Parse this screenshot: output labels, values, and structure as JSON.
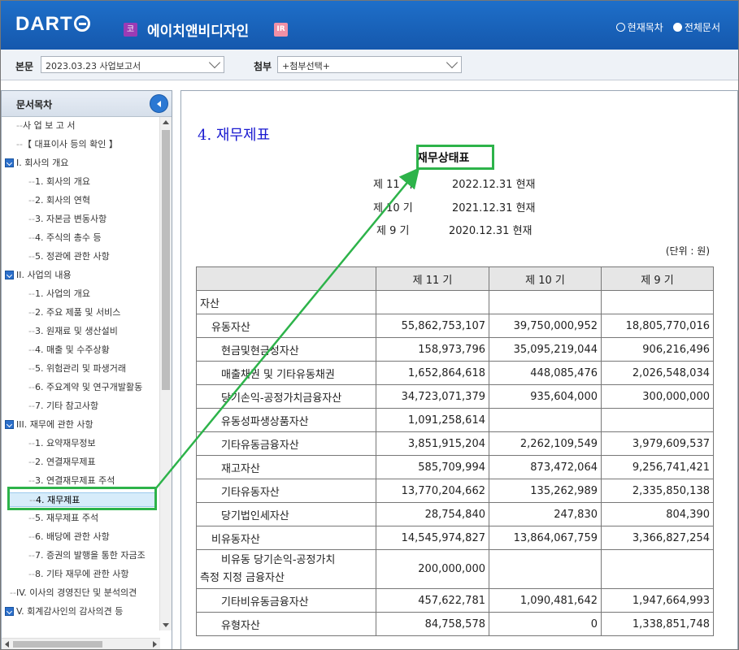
{
  "header": {
    "logo_text": "DART",
    "company_badge": "코",
    "company_name": "에이치앤비디자인",
    "ir_badge": "IR",
    "radio_current": "현재목차",
    "radio_all": "전체문서"
  },
  "selectbar": {
    "body_label": "본문",
    "body_value": "2023.03.23  사업보고서",
    "attach_label": "첨부",
    "attach_value": "+첨부선택+"
  },
  "sidebar": {
    "title": "문서목차",
    "items": [
      {
        "label": "사 업 보 고 서"
      },
      {
        "label": "【 대표이사 등의 확인 】"
      },
      {
        "label": "I. 회사의 개요"
      },
      {
        "label": "1. 회사의 개요"
      },
      {
        "label": "2. 회사의 연혁"
      },
      {
        "label": "3. 자본금 변동사항"
      },
      {
        "label": "4. 주식의 총수 등"
      },
      {
        "label": "5. 정관에 관한 사항"
      },
      {
        "label": "II. 사업의 내용"
      },
      {
        "label": "1. 사업의 개요"
      },
      {
        "label": "2. 주요 제품 및 서비스"
      },
      {
        "label": "3. 원재료 및 생산설비"
      },
      {
        "label": "4. 매출 및 수주상황"
      },
      {
        "label": "5. 위험관리 및 파생거래"
      },
      {
        "label": "6. 주요계약 및 연구개발활동"
      },
      {
        "label": "7. 기타 참고사항"
      },
      {
        "label": "III. 재무에 관한 사항"
      },
      {
        "label": "1. 요약재무정보"
      },
      {
        "label": "2. 연결재무제표"
      },
      {
        "label": "3. 연결재무제표 주석"
      },
      {
        "label": "4. 재무제표"
      },
      {
        "label": "5. 재무제표 주석"
      },
      {
        "label": "6. 배당에 관한 사항"
      },
      {
        "label": "7. 증권의 발행을 통한 자금조"
      },
      {
        "label": "8. 기타 재무에 관한 사항"
      },
      {
        "label": "IV. 이사의 경영진단 및 분석의견"
      },
      {
        "label": "V. 회계감사인의 감사의견 등"
      }
    ]
  },
  "content": {
    "doc_title": "4. 재무제표",
    "fs_title": "재무상태표",
    "periods": [
      {
        "label": "제 11 기",
        "date": "2022.12.31 현재"
      },
      {
        "label": "제 10 기",
        "date": "2021.12.31 현재"
      },
      {
        "label": "제 9 기",
        "date": "2020.12.31 현재"
      }
    ],
    "unit": "(단위 : 원)",
    "columns": [
      "",
      "제 11 기",
      "제 10 기",
      "제 9 기"
    ],
    "rows": [
      {
        "account": "자산",
        "v11": "",
        "v10": "",
        "v9": ""
      },
      {
        "account": "유동자산",
        "v11": "55,862,753,107",
        "v10": "39,750,000,952",
        "v9": "18,805,770,016"
      },
      {
        "account": "현금및현금성자산",
        "v11": "158,973,796",
        "v10": "35,095,219,044",
        "v9": "906,216,496"
      },
      {
        "account": "매출채권 및 기타유동채권",
        "v11": "1,652,864,618",
        "v10": "448,085,476",
        "v9": "2,026,548,034"
      },
      {
        "account": "당기손익-공정가치금융자산",
        "v11": "34,723,071,379",
        "v10": "935,604,000",
        "v9": "300,000,000"
      },
      {
        "account": "유동성파생상품자산",
        "v11": "1,091,258,614",
        "v10": "",
        "v9": ""
      },
      {
        "account": "기타유동금융자산",
        "v11": "3,851,915,204",
        "v10": "2,262,109,549",
        "v9": "3,979,609,537"
      },
      {
        "account": "재고자산",
        "v11": "585,709,994",
        "v10": "873,472,064",
        "v9": "9,256,741,421"
      },
      {
        "account": "기타유동자산",
        "v11": "13,770,204,662",
        "v10": "135,262,989",
        "v9": "2,335,850,138"
      },
      {
        "account": "당기법인세자산",
        "v11": "28,754,840",
        "v10": "247,830",
        "v9": "804,390"
      },
      {
        "account": "비유동자산",
        "v11": "14,545,974,827",
        "v10": "13,864,067,759",
        "v9": "3,366,827,254"
      },
      {
        "account_line1": "비유동 당기손익-공정가치",
        "account_line2": "측정 지정 금융자산",
        "v11": "200,000,000",
        "v10": "",
        "v9": ""
      },
      {
        "account": "기타비유동금융자산",
        "v11": "457,622,781",
        "v10": "1,090,481,642",
        "v9": "1,947,664,993"
      },
      {
        "account": "유형자산",
        "v11": "84,758,578",
        "v10": "0",
        "v9": "1,338,851,748"
      }
    ]
  },
  "annotation_color": "#2db34a"
}
